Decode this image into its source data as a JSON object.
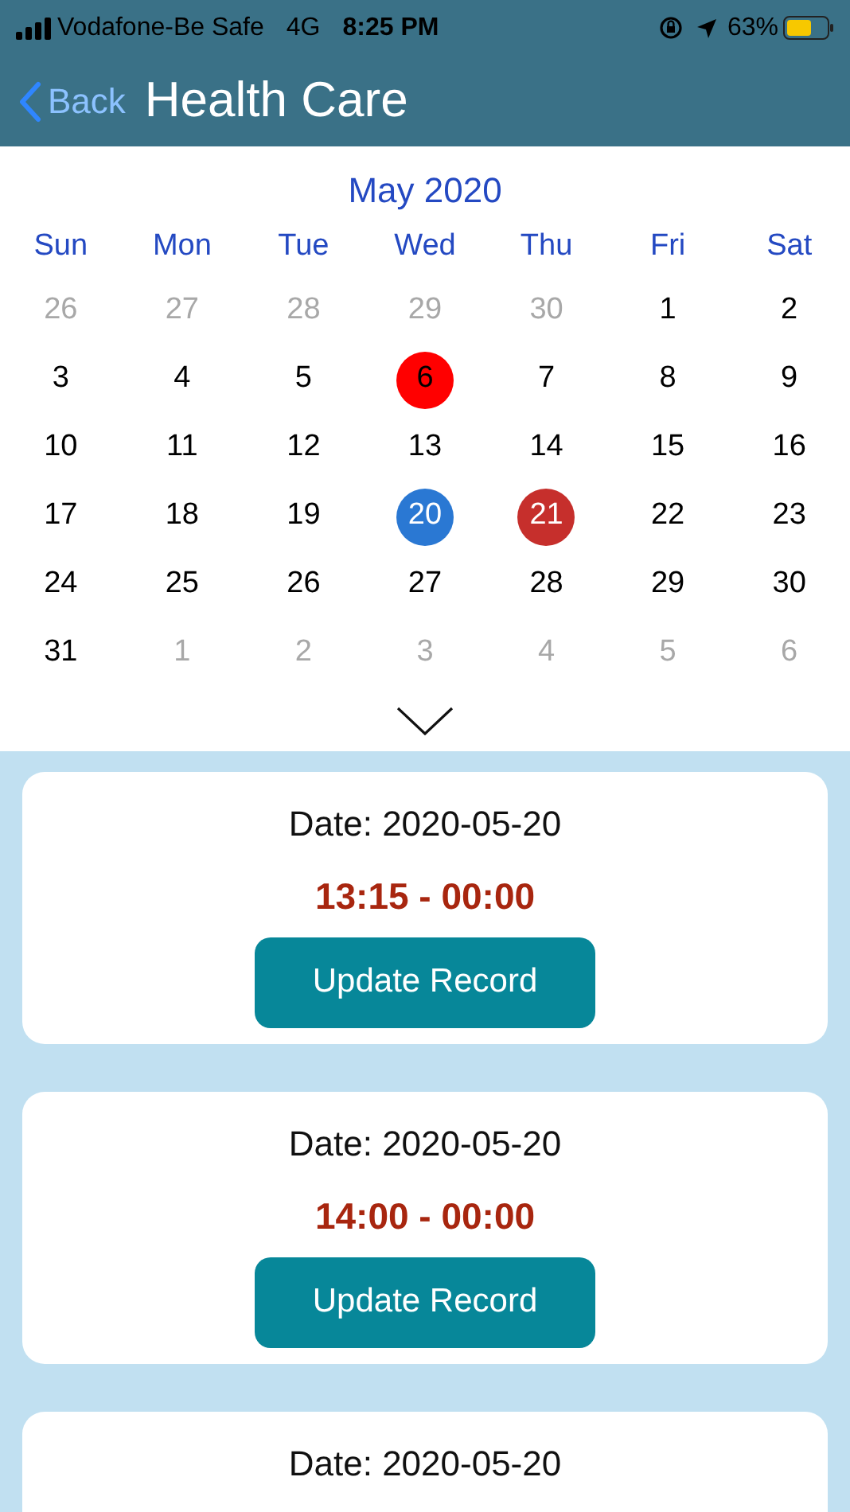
{
  "status_bar": {
    "carrier": "Vodafone-Be Safe",
    "network": "4G",
    "time": "8:25 PM",
    "battery": "63%"
  },
  "nav": {
    "back": "Back",
    "title": "Health Care"
  },
  "calendar": {
    "month": "May 2020",
    "weekdays": [
      "Sun",
      "Mon",
      "Tue",
      "Wed",
      "Thu",
      "Fri",
      "Sat"
    ],
    "days": [
      {
        "label": "26",
        "in_month": false,
        "selected": false
      },
      {
        "label": "27",
        "in_month": false,
        "selected": false
      },
      {
        "label": "28",
        "in_month": false,
        "selected": false
      },
      {
        "label": "29",
        "in_month": false,
        "selected": false
      },
      {
        "label": "30",
        "in_month": false,
        "selected": false
      },
      {
        "label": "1",
        "in_month": true,
        "selected": false
      },
      {
        "label": "2",
        "in_month": true,
        "selected": false
      },
      {
        "label": "3",
        "in_month": true,
        "selected": false
      },
      {
        "label": "4",
        "in_month": true,
        "selected": false
      },
      {
        "label": "5",
        "in_month": true,
        "selected": false
      },
      {
        "label": "6",
        "in_month": true,
        "selected": false,
        "color": "#ff0000"
      },
      {
        "label": "7",
        "in_month": true,
        "selected": false
      },
      {
        "label": "8",
        "in_month": true,
        "selected": false
      },
      {
        "label": "9",
        "in_month": true,
        "selected": false
      },
      {
        "label": "10",
        "in_month": true,
        "selected": false
      },
      {
        "label": "11",
        "in_month": true,
        "selected": false
      },
      {
        "label": "12",
        "in_month": true,
        "selected": false
      },
      {
        "label": "13",
        "in_month": true,
        "selected": false
      },
      {
        "label": "14",
        "in_month": true,
        "selected": false
      },
      {
        "label": "15",
        "in_month": true,
        "selected": false
      },
      {
        "label": "16",
        "in_month": true,
        "selected": false
      },
      {
        "label": "17",
        "in_month": true,
        "selected": false
      },
      {
        "label": "18",
        "in_month": true,
        "selected": false
      },
      {
        "label": "19",
        "in_month": true,
        "selected": false
      },
      {
        "label": "20",
        "in_month": true,
        "selected": true
      },
      {
        "label": "21",
        "in_month": true,
        "selected": false,
        "color": "#c62f2c"
      },
      {
        "label": "22",
        "in_month": true,
        "selected": false
      },
      {
        "label": "23",
        "in_month": true,
        "selected": false
      },
      {
        "label": "24",
        "in_month": true,
        "selected": false
      },
      {
        "label": "25",
        "in_month": true,
        "selected": false
      },
      {
        "label": "26",
        "in_month": true,
        "selected": false
      },
      {
        "label": "27",
        "in_month": true,
        "selected": false
      },
      {
        "label": "28",
        "in_month": true,
        "selected": false
      },
      {
        "label": "29",
        "in_month": true,
        "selected": false
      },
      {
        "label": "30",
        "in_month": true,
        "selected": false
      },
      {
        "label": "31",
        "in_month": true,
        "selected": false
      },
      {
        "label": "1",
        "in_month": false,
        "selected": false
      },
      {
        "label": "2",
        "in_month": false,
        "selected": false
      },
      {
        "label": "3",
        "in_month": false,
        "selected": false
      },
      {
        "label": "4",
        "in_month": false,
        "selected": false
      },
      {
        "label": "5",
        "in_month": false,
        "selected": false
      },
      {
        "label": "6",
        "in_month": false,
        "selected": false
      }
    ]
  },
  "records": [
    {
      "date": "Date: 2020-05-20",
      "time": "13:15 - 00:00",
      "button": "Update Record"
    },
    {
      "date": "Date: 2020-05-20",
      "time": "14:00 - 00:00",
      "button": "Update Record"
    },
    {
      "date": "Date: 2020-05-20"
    }
  ]
}
